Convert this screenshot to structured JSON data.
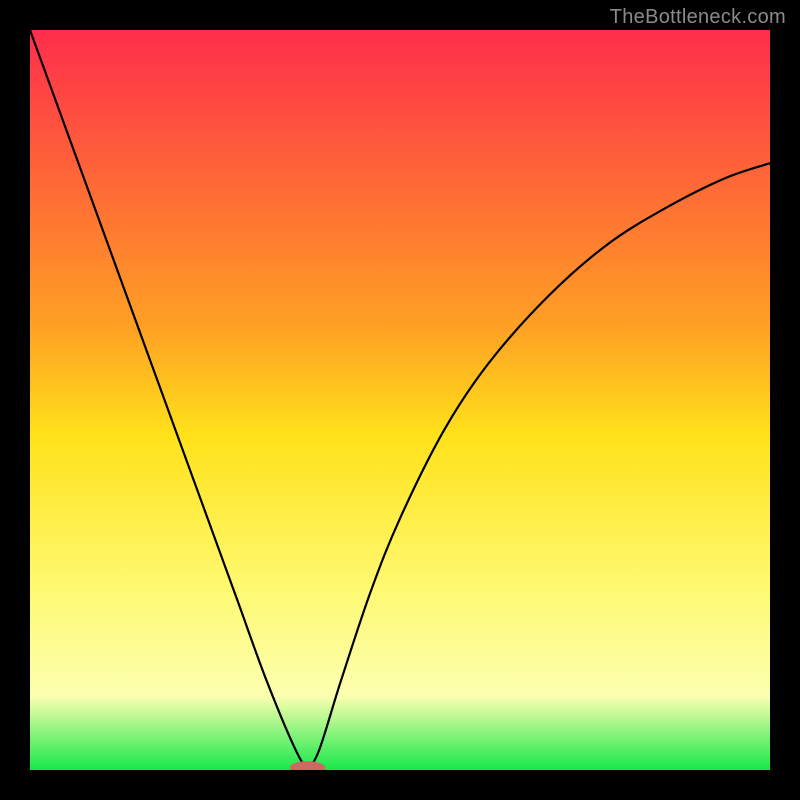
{
  "watermark": "TheBottleneck.com",
  "chart_data": {
    "type": "line",
    "title": "",
    "xlabel": "",
    "ylabel": "",
    "xlim": [
      0,
      100
    ],
    "ylim": [
      0,
      100
    ],
    "grid": false,
    "legend": false,
    "gradient_stops": [
      {
        "offset": 0,
        "color": "#ff2d4b"
      },
      {
        "offset": 40,
        "color": "#ffa024"
      },
      {
        "offset": 55,
        "color": "#ffe21a"
      },
      {
        "offset": 75,
        "color": "#fff970"
      },
      {
        "offset": 90,
        "color": "#fcffb0"
      },
      {
        "offset": 100,
        "color": "#17e84a"
      }
    ],
    "series": [
      {
        "name": "bottleneck-curve",
        "x": [
          0,
          4,
          8,
          12,
          16,
          20,
          24,
          28,
          32,
          36,
          37.5,
          39,
          42,
          46,
          50,
          56,
          62,
          70,
          78,
          86,
          94,
          100
        ],
        "y": [
          100,
          89,
          78,
          67,
          56,
          45,
          34,
          23,
          12,
          2.5,
          0.7,
          2.5,
          12,
          24,
          34,
          46,
          55,
          64,
          71,
          76,
          80,
          82
        ]
      }
    ],
    "marker": {
      "x": 37.5,
      "y": 0.3,
      "rx": 2.4,
      "ry": 0.9,
      "color": "#c96b63"
    }
  }
}
